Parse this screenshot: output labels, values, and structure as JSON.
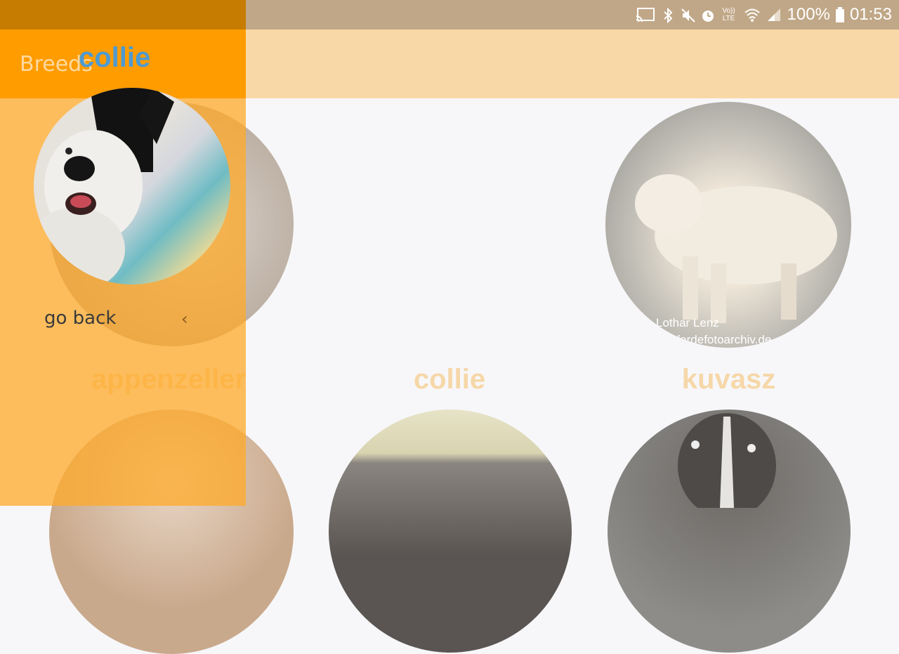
{
  "status_bar": {
    "left_icons": [
      "video-camera-icon",
      "bed-icon",
      "shield-icon"
    ],
    "overflow": "...",
    "right_icons": [
      "cast-icon",
      "bluetooth-icon",
      "mute-icon",
      "alarm-icon",
      "volte-icon",
      "wifi-icon",
      "signal-icon",
      "battery-icon"
    ],
    "volte_label": "Vo)) LTE",
    "battery": "100%",
    "time": "01:53"
  },
  "drawer": {
    "header_label": "Breeds",
    "title": "collie",
    "go_back": "go back",
    "chevron": "‹"
  },
  "grid": {
    "row1": [
      {
        "label": "",
        "photo_caption_1": "",
        "photo_caption_2": ""
      },
      {
        "label": "",
        "photo_caption_1": "",
        "photo_caption_2": ""
      },
      {
        "label": "",
        "photo_caption_1": "Lothar Lenz",
        "photo_caption_2": "pferdefotoarchiv.de"
      }
    ],
    "labels_row2": [
      "appenzeller",
      "collie",
      "kuvasz"
    ]
  },
  "colors": {
    "status_bar": "#c0a787",
    "app_bar": "#f8d8a6",
    "drawer": "#ff9c00",
    "accent_title": "#4e9ad1",
    "breed_label": "#f6d7a8"
  }
}
